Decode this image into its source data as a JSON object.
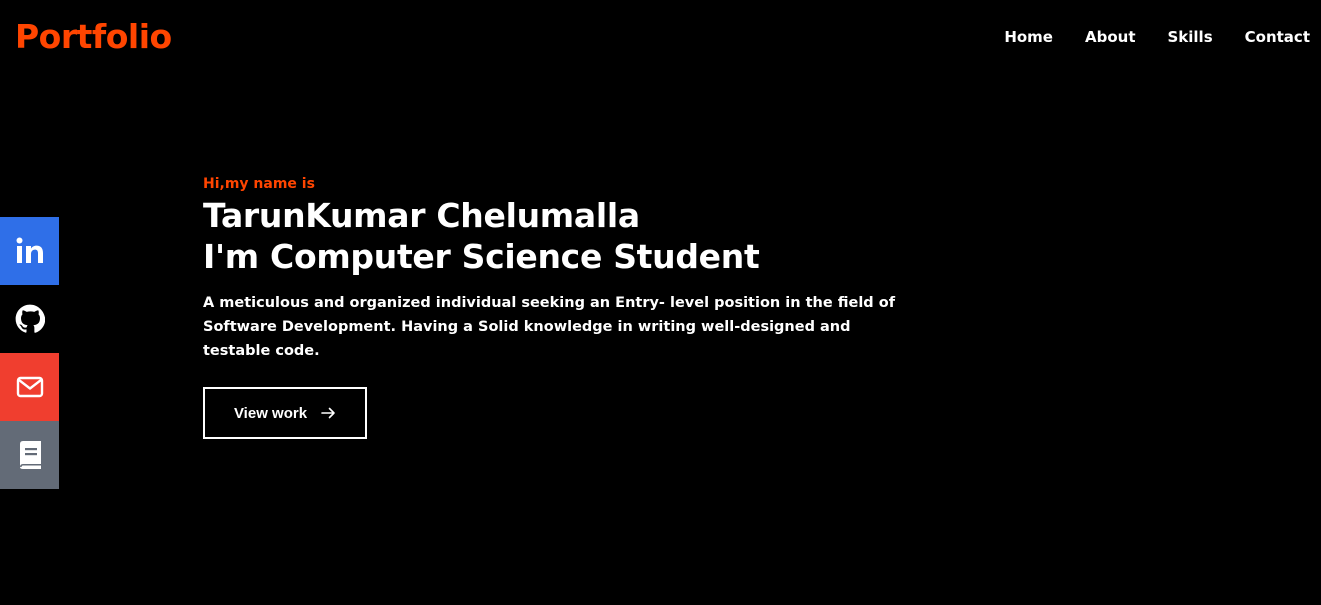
{
  "header": {
    "brand": "Portfolio",
    "nav": [
      {
        "label": "Home"
      },
      {
        "label": "About"
      },
      {
        "label": "Skills"
      },
      {
        "label": "Contact"
      }
    ]
  },
  "social": [
    {
      "icon": "linkedin-icon",
      "color": "#2f6fe8"
    },
    {
      "icon": "github-icon",
      "color": "#000000"
    },
    {
      "icon": "mail-icon",
      "color": "#f03e2f"
    },
    {
      "icon": "book-icon",
      "color": "#636b77"
    }
  ],
  "hero": {
    "greeting": "Hi,my name is",
    "name": "TarunKumar Chelumalla",
    "role": "I'm Computer Science Student",
    "description": "A meticulous and organized individual seeking an Entry- level position in the field of Software Development. Having a Solid knowledge in writing well-designed and testable code.",
    "cta_label": "View work",
    "cta_icon": "arrow-right-icon"
  },
  "colors": {
    "accent": "#ff4500",
    "background": "#000000",
    "text": "#ffffff"
  }
}
